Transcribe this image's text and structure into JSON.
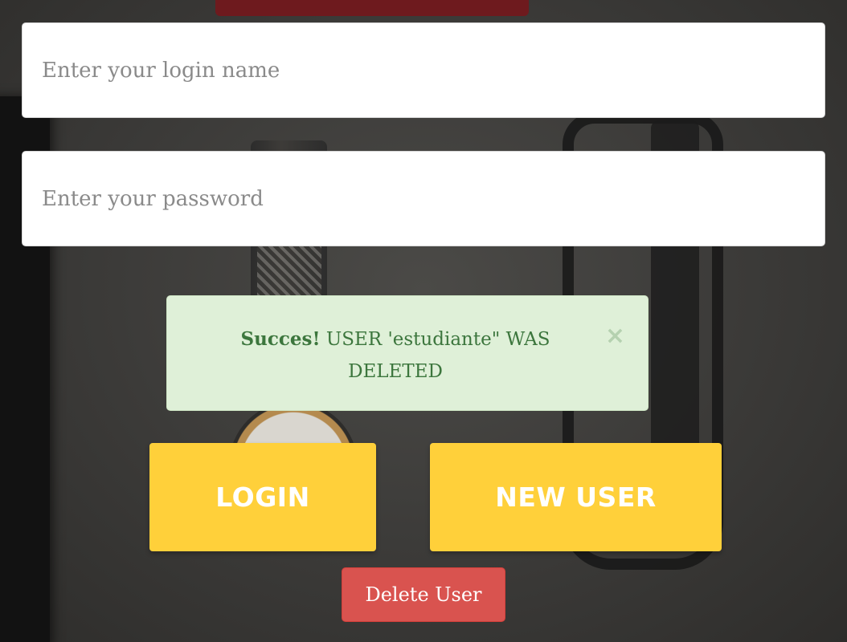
{
  "form": {
    "login_placeholder": "Enter your login name",
    "password_placeholder": "Enter your password"
  },
  "alert": {
    "title": "Succes!",
    "message": "USER 'estudiante\" WAS DELETED",
    "close_glyph": "×"
  },
  "buttons": {
    "login_label": "LOGIN",
    "new_user_label": "NEW USER",
    "delete_user_label": "Delete User"
  },
  "colors": {
    "alert_background": "#dff0d8",
    "alert_text": "#3c763d",
    "primary_button": "#ffd03a",
    "danger_button": "#d9534f"
  }
}
